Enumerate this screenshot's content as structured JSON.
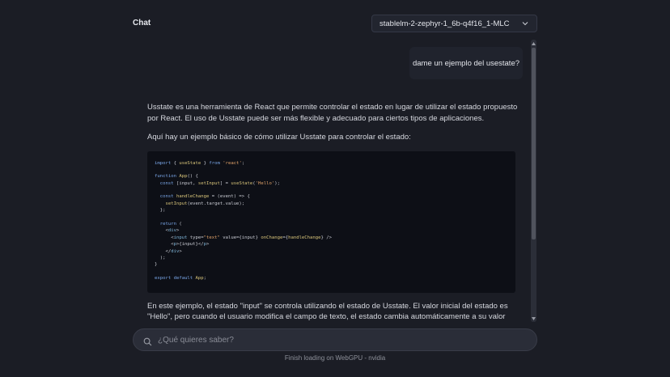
{
  "header": {
    "title": "Chat"
  },
  "model_select": {
    "value": "stablelm-2-zephyr-1_6b-q4f16_1-MLC",
    "icon": "chevron-down-icon"
  },
  "messages": {
    "user": "dame un ejemplo del usestate?",
    "assistant": {
      "p1": "Usstate es una herramienta de React que permite controlar el estado en lugar de utilizar el estado propuesto por React. El uso de Usstate puede ser más flexible y adecuado para ciertos tipos de aplicaciones.",
      "p2": "Aquí hay un ejemplo básico de cómo utilizar Usstate para controlar el estado:",
      "code": [
        "import { useState } from 'react';",
        "",
        "function App() {",
        "  const [input, setInput] = useState('Hello');",
        "",
        "  const handleChange = (event) => {",
        "    setInput(event.target.value);",
        "  };",
        "",
        "  return (",
        "    <div>",
        "      <input type=\"text\" value={input} onChange={handleChange} />",
        "      <p>{input}</p>",
        "    </div>",
        "  );",
        "}",
        "",
        "export default App;"
      ],
      "p3": "En este ejemplo, el estado \"input\" se controla utilizando el estado de Usstate. El valor inicial del estado es \"Hello\", pero cuando el usuario modifica el campo de texto, el estado cambia automáticamente a su valor actualizado. El"
    }
  },
  "search": {
    "placeholder": "¿Qué quieres saber?",
    "value": "",
    "icon": "search-icon"
  },
  "status": "Finish loading on WebGPU - nvidia",
  "colors": {
    "background": "#1b1d25",
    "code_bg": "#0d0f16",
    "bubble_bg": "#20232d",
    "input_bg": "#2a2d38"
  }
}
